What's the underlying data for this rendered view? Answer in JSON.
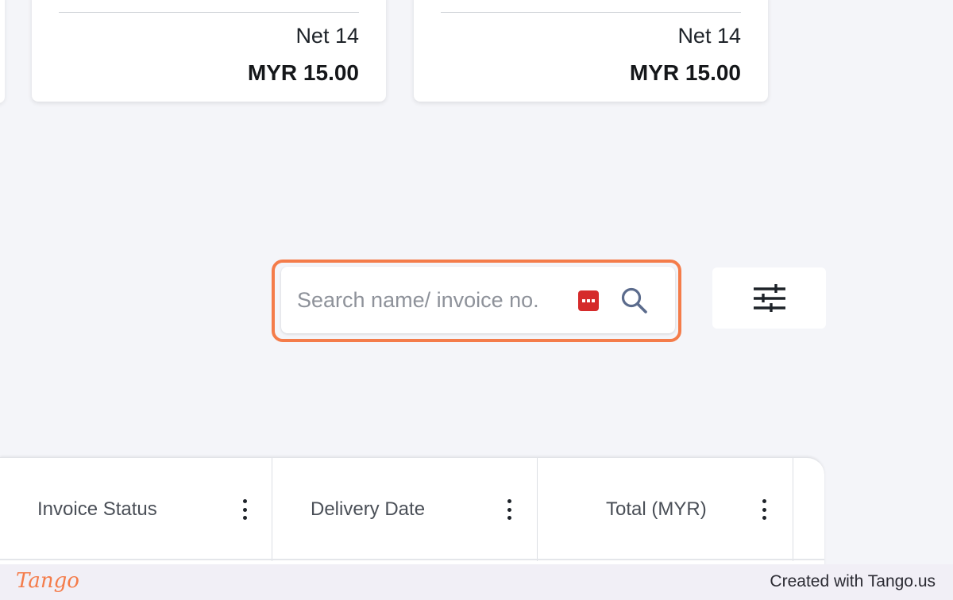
{
  "cards": [
    {
      "term": "Net 14",
      "amount": "MYR 15.00"
    },
    {
      "term": "Net 14",
      "amount": "MYR 15.00"
    }
  ],
  "search": {
    "placeholder": "Search name/ invoice no.",
    "value": ""
  },
  "icons": {
    "search": "search-icon",
    "filter": "sliders-icon",
    "extension": "password-manager-icon",
    "column_menu": "kebab-vertical-icon"
  },
  "table": {
    "columns": [
      {
        "label": "Invoice Status"
      },
      {
        "label": "Delivery Date"
      },
      {
        "label": "Total (MYR)"
      }
    ]
  },
  "footer": {
    "logo": "Tango",
    "credit": "Created with Tango.us"
  },
  "colors": {
    "background": "#f4f5f9",
    "highlight": "#f47c4a",
    "extension_icon": "#d52b2b",
    "search_icon": "#5b6b8c"
  }
}
